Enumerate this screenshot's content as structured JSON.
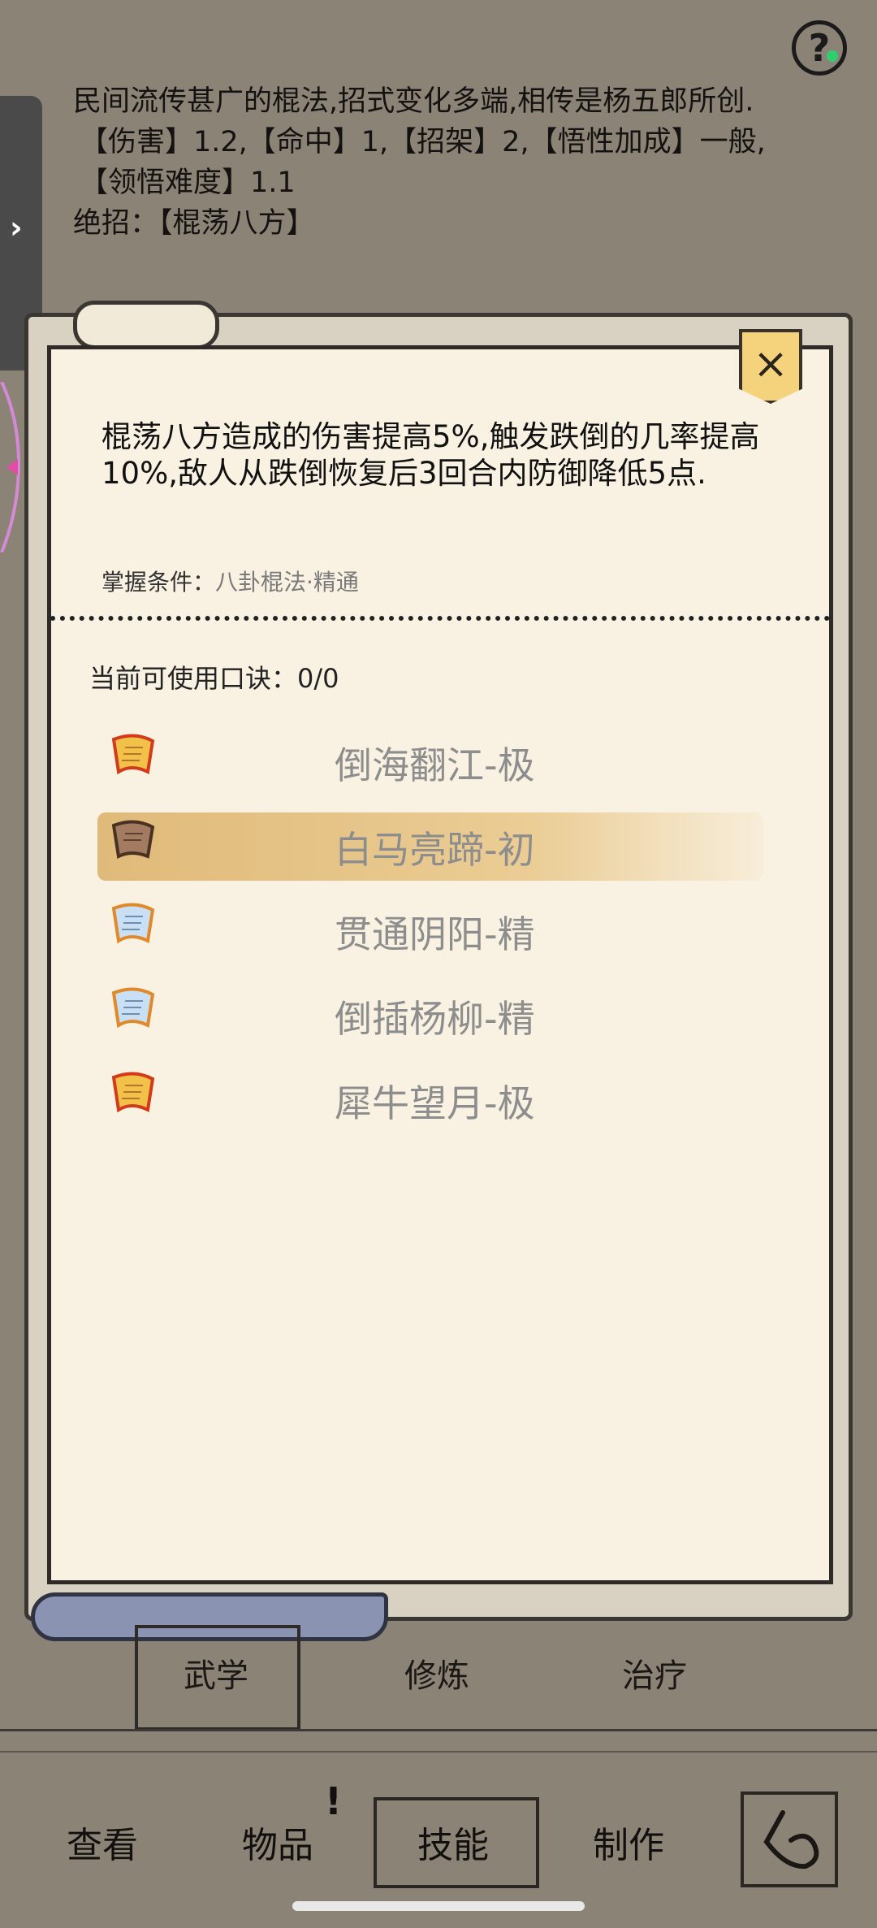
{
  "header": {
    "description": "民间流传甚广的棍法,招式变化多端,相传是杨五郎所创.",
    "stats_line1": "【伤害】1.2,【命中】1,【招架】2,【悟性加成】一般,",
    "stats_line2": "【领悟难度】1.1",
    "ultimate_label": "绝招：",
    "ultimate_value": "【棍荡八方】",
    "help_label": "?",
    "side_tab_arrow": "›"
  },
  "panel": {
    "close_label": "×",
    "effect": "棍荡八方造成的伤害提高5%,触发跌倒的几率提高10%,敌人从跌倒恢复后3回合内防御降低5点.",
    "requirement_label": "掌握条件：",
    "requirement_value": "八卦棍法·精通",
    "available_label": "当前可使用口诀：",
    "available_value": "0/0",
    "formulas": [
      {
        "name": "倒海翻江-极",
        "icon": "gold-scroll-icon",
        "selected": false
      },
      {
        "name": "白马亮蹄-初",
        "icon": "brown-scroll-icon",
        "selected": true
      },
      {
        "name": "贯通阴阳-精",
        "icon": "blue-scroll-icon",
        "selected": false
      },
      {
        "name": "倒插杨柳-精",
        "icon": "blue-scroll-icon",
        "selected": false
      },
      {
        "name": "犀牛望月-极",
        "icon": "gold-scroll-icon",
        "selected": false
      }
    ]
  },
  "subtabs": [
    "武学",
    "修炼",
    "治疗"
  ],
  "nav": {
    "items": [
      "查看",
      "物品",
      "技能",
      "制作"
    ],
    "item_badge": "!",
    "active": "技能"
  },
  "colors": {
    "background": "#8c8377",
    "panel": "#f9f2e3",
    "gold": "#f4d37c",
    "formula_text": "#8d8d8d"
  }
}
